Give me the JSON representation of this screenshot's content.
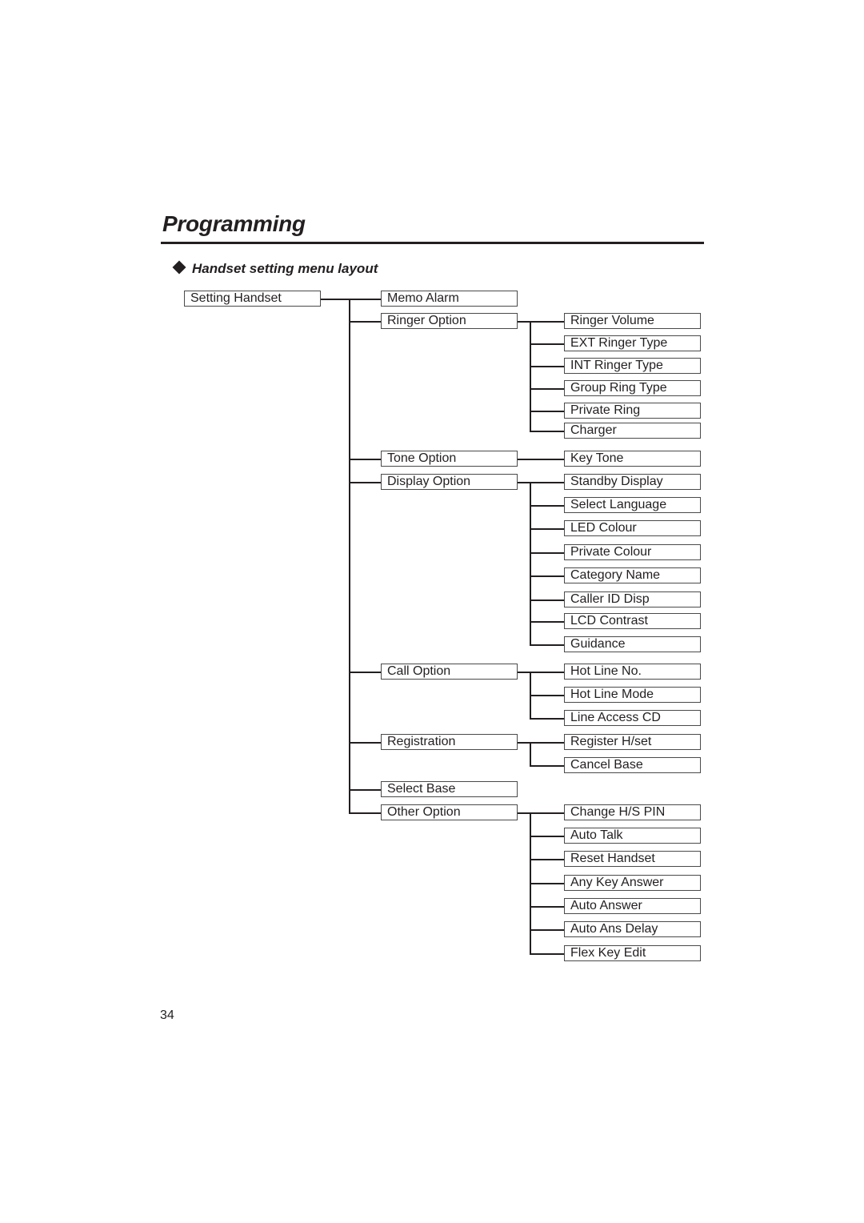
{
  "page": {
    "section_title": "Programming",
    "heading_icon": "diamond-bullet-icon",
    "heading": "Handset setting menu layout",
    "page_number": "34"
  },
  "menu": {
    "root": "Setting Handset",
    "items": [
      {
        "label": "Memo Alarm",
        "children": []
      },
      {
        "label": "Ringer Option",
        "children": [
          "Ringer Volume",
          "EXT Ringer Type",
          "INT Ringer Type",
          "Group Ring Type",
          "Private Ring",
          "Charger"
        ]
      },
      {
        "label": "Tone Option",
        "children": [
          "Key Tone"
        ]
      },
      {
        "label": "Display Option",
        "children": [
          "Standby Display",
          "Select Language",
          "LED Colour",
          "Private Colour",
          "Category Name",
          "Caller ID Disp",
          "LCD Contrast",
          "Guidance"
        ]
      },
      {
        "label": "Call Option",
        "children": [
          "Hot Line No.",
          "Hot Line Mode",
          "Line Access CD"
        ]
      },
      {
        "label": "Registration",
        "children": [
          "Register H/set",
          "Cancel Base"
        ]
      },
      {
        "label": "Select Base",
        "children": []
      },
      {
        "label": "Other Option",
        "children": [
          "Change H/S PIN",
          "Auto Talk",
          "Reset Handset",
          "Any Key Answer",
          "Auto Answer",
          "Auto Ans Delay",
          "Flex Key Edit"
        ]
      }
    ]
  }
}
